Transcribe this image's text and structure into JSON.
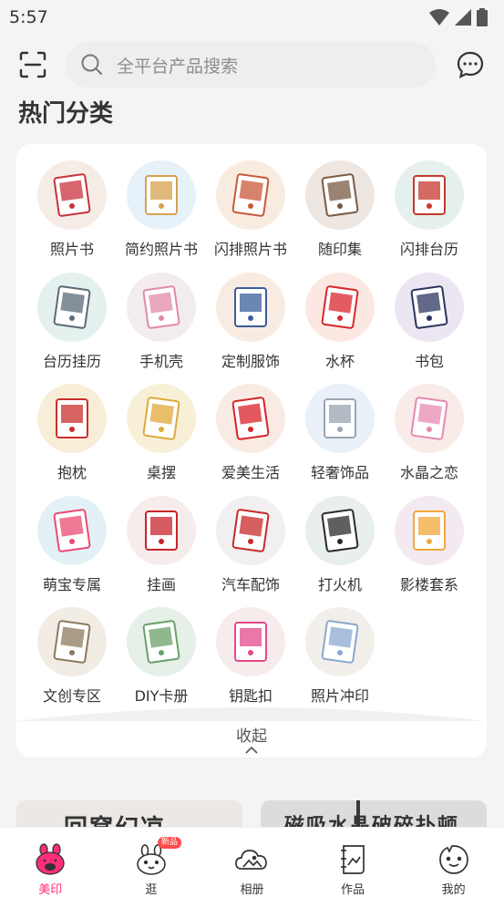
{
  "status_bar": {
    "time": "5:57"
  },
  "search": {
    "placeholder": "全平台产品搜索"
  },
  "section": {
    "title": "热门分类"
  },
  "categories": [
    {
      "label": "照片书",
      "bg": "#f6ece6",
      "accent": "#c8323c"
    },
    {
      "label": "简约照片书",
      "bg": "#e6f1fa",
      "accent": "#d6a24e"
    },
    {
      "label": "闪排照片书",
      "bg": "#f8ebdf",
      "accent": "#c95a3a"
    },
    {
      "label": "随印集",
      "bg": "#eee6e0",
      "accent": "#7a5a45"
    },
    {
      "label": "闪排台历",
      "bg": "#e6f0ec",
      "accent": "#c53a2f"
    },
    {
      "label": "台历挂历",
      "bg": "#e4f1ee",
      "accent": "#5a6b78"
    },
    {
      "label": "手机壳",
      "bg": "#f3ecef",
      "accent": "#e18aa6"
    },
    {
      "label": "定制服饰",
      "bg": "#f8ece2",
      "accent": "#3a5e9a"
    },
    {
      "label": "水杯",
      "bg": "#fbe8e2",
      "accent": "#d9262c"
    },
    {
      "label": "书包",
      "bg": "#ece6f3",
      "accent": "#2c3560"
    },
    {
      "label": "抱枕",
      "bg": "#f8eed8",
      "accent": "#c9302c"
    },
    {
      "label": "桌摆",
      "bg": "#f7f0d6",
      "accent": "#e0a83a"
    },
    {
      "label": "爱美生活",
      "bg": "#f9ebe4",
      "accent": "#d8232a"
    },
    {
      "label": "轻奢饰品",
      "bg": "#e9f0f7",
      "accent": "#9aa6b2"
    },
    {
      "label": "水晶之恋",
      "bg": "#f8ebe8",
      "accent": "#e58bb0"
    },
    {
      "label": "萌宝专属",
      "bg": "#e3f1f6",
      "accent": "#e94b72"
    },
    {
      "label": "挂画",
      "bg": "#f6eceb",
      "accent": "#c8242b"
    },
    {
      "label": "汽车配饰",
      "bg": "#f1efef",
      "accent": "#c82a2a"
    },
    {
      "label": "打火机",
      "bg": "#e9eeee",
      "accent": "#2a2a2a"
    },
    {
      "label": "影楼套系",
      "bg": "#f3e9f1",
      "accent": "#f0a83c"
    },
    {
      "label": "文创专区",
      "bg": "#f1ece4",
      "accent": "#8c7a5e"
    },
    {
      "label": "DIY卡册",
      "bg": "#e6efe8",
      "accent": "#6aa06a"
    },
    {
      "label": "钥匙扣",
      "bg": "#f6eceb",
      "accent": "#e24a8a"
    },
    {
      "label": "照片冲印",
      "bg": "#f2efeb",
      "accent": "#8aa8d0"
    }
  ],
  "collapse": {
    "label": "收起"
  },
  "banners": {
    "left_text": "回窝幻凉",
    "right_text": "磁吸水晶破碎扑顿"
  },
  "nav": [
    {
      "label": "美印",
      "icon": "meiyin-bunny-icon",
      "active": true
    },
    {
      "label": "逛",
      "icon": "browse-bunny-icon",
      "badge": "新品"
    },
    {
      "label": "相册",
      "icon": "album-cloud-icon"
    },
    {
      "label": "作品",
      "icon": "works-frame-icon"
    },
    {
      "label": "我的",
      "icon": "profile-face-icon"
    }
  ],
  "colors": {
    "accent": "#ff2d7a",
    "page_bg": "#f4f4f6",
    "card_bg": "#ffffff"
  }
}
